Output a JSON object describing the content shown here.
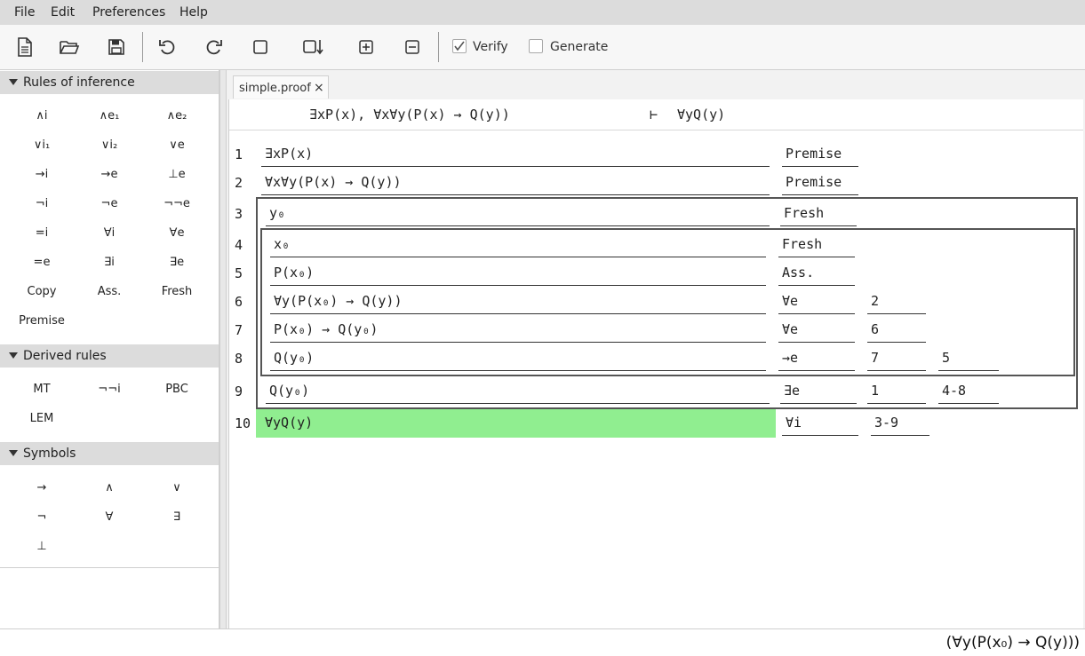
{
  "menu": [
    "File",
    "Edit",
    "Preferences",
    "Help"
  ],
  "toolbar": {
    "buttons": [
      "new-file-icon",
      "open-folder-icon",
      "save-icon",
      "undo-icon",
      "redo-icon",
      "square-icon",
      "square-arrow-down-icon",
      "plus-square-icon",
      "minus-square-icon"
    ],
    "verify_label": "Verify",
    "verify_checked": true,
    "generate_label": "Generate",
    "generate_checked": false
  },
  "sidebar": {
    "rules_header": "Rules of inference",
    "rules": [
      "∧i",
      "∧e₁",
      "∧e₂",
      "∨i₁",
      "∨i₂",
      "∨e",
      "→i",
      "→e",
      "⊥e",
      "¬i",
      "¬e",
      "¬¬e",
      "=i",
      "∀i",
      "∀e",
      "=e",
      "∃i",
      "∃e",
      "Copy",
      "Ass.",
      "Fresh",
      "Premise"
    ],
    "derived_header": "Derived rules",
    "derived": [
      "MT",
      "¬¬i",
      "PBC",
      "LEM"
    ],
    "symbols_header": "Symbols",
    "symbols": [
      "→",
      "∧",
      "∨",
      "¬",
      "∀",
      "∃",
      "⊥"
    ]
  },
  "tab": {
    "label": "simple.proof",
    "close": "×"
  },
  "sequent": {
    "premises": "∃xP(x), ∀x∀y(P(x) → Q(y))",
    "turnstile": "⊢",
    "conclusion": "∀yQ(y)"
  },
  "proof": {
    "lines": [
      {
        "num": "1",
        "formula": "∃xP(x)",
        "rule": "Premise",
        "refs": []
      },
      {
        "num": "2",
        "formula": "∀x∀y(P(x) → Q(y))",
        "rule": "Premise",
        "refs": []
      },
      {
        "num": "3",
        "formula": "y₀",
        "rule": "Fresh",
        "refs": []
      },
      {
        "num": "4",
        "formula": "x₀",
        "rule": "Fresh",
        "refs": []
      },
      {
        "num": "5",
        "formula": "P(x₀)",
        "rule": "Ass.",
        "refs": []
      },
      {
        "num": "6",
        "formula": "∀y(P(x₀) → Q(y))",
        "rule": "∀e",
        "refs": [
          "2"
        ]
      },
      {
        "num": "7",
        "formula": "P(x₀) → Q(y₀)",
        "rule": "∀e",
        "refs": [
          "6"
        ]
      },
      {
        "num": "8",
        "formula": "Q(y₀)",
        "rule": "→e",
        "refs": [
          "7",
          "5"
        ]
      },
      {
        "num": "9",
        "formula": "Q(y₀)",
        "rule": "∃e",
        "refs": [
          "1",
          "4-8"
        ]
      },
      {
        "num": "10",
        "formula": "∀yQ(y)",
        "rule": "∀i",
        "refs": [
          "3-9"
        ]
      }
    ],
    "conclusion_color": "#90ee90"
  },
  "status": {
    "text": "(∀y(P(x₀) → Q(y)))"
  }
}
